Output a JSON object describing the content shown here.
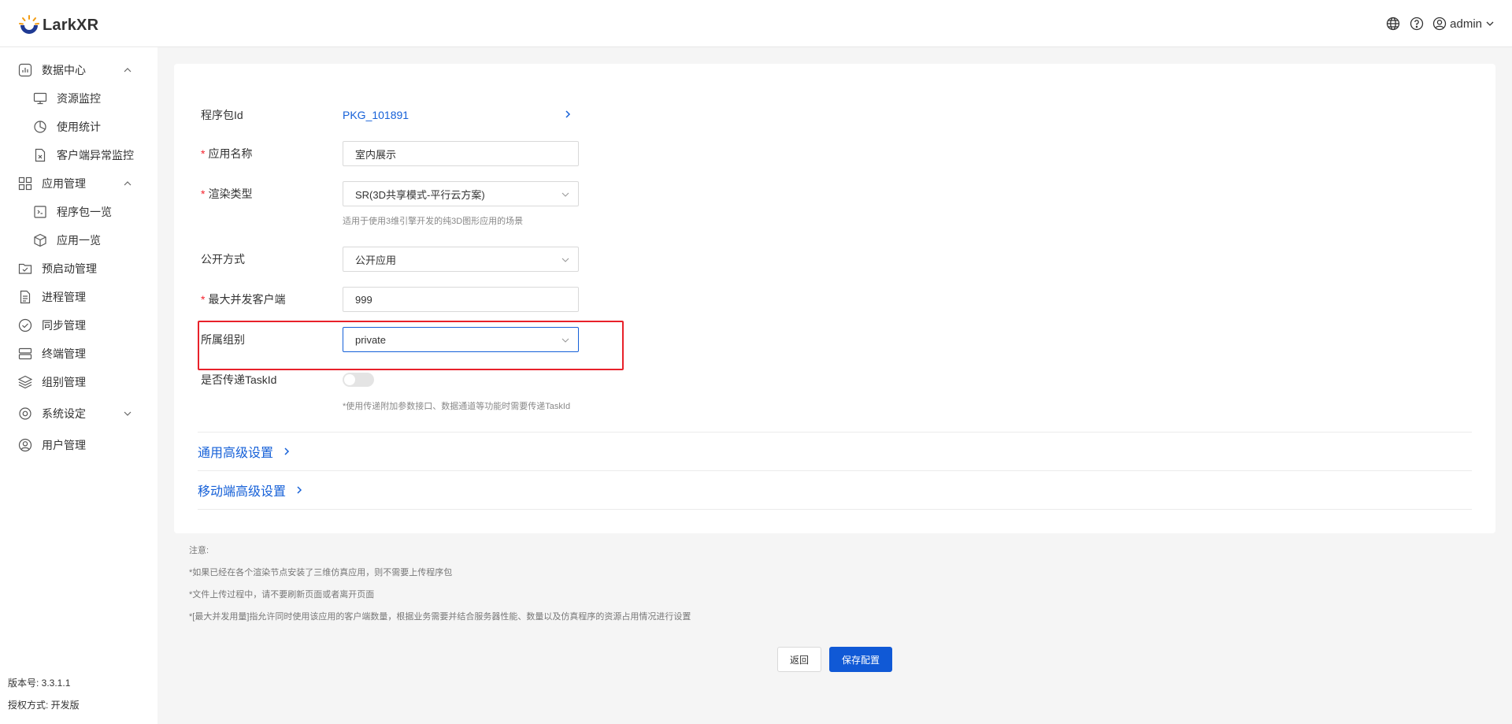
{
  "app": {
    "brand": "LarkXR",
    "user": "admin"
  },
  "colors": {
    "accent": "#1560d8",
    "required": "#f5222d",
    "highlight": "#e8212a",
    "primary_button": "#1059d6"
  },
  "sidebar": {
    "items": [
      {
        "label": "数据中心",
        "icon": "bar-chart-icon"
      },
      {
        "label": "资源监控",
        "icon": "monitor-icon"
      },
      {
        "label": "使用统计",
        "icon": "pie-chart-icon"
      },
      {
        "label": "客户端异常监控",
        "icon": "file-error-icon"
      },
      {
        "label": "应用管理",
        "icon": "app-grid-icon"
      },
      {
        "label": "程序包一览",
        "icon": "package-icon"
      },
      {
        "label": "应用一览",
        "icon": "cube-icon"
      },
      {
        "label": "预启动管理",
        "icon": "folder-check-icon"
      },
      {
        "label": "进程管理",
        "icon": "document-icon"
      },
      {
        "label": "同步管理",
        "icon": "check-circle-icon"
      },
      {
        "label": "终端管理",
        "icon": "server-icon"
      },
      {
        "label": "组别管理",
        "icon": "layers-icon"
      },
      {
        "label": "系统设定",
        "icon": "settings-icon"
      },
      {
        "label": "用户管理",
        "icon": "user-icon"
      }
    ],
    "version": "版本号: 3.3.1.1",
    "license": "授权方式: 开发版"
  },
  "form": {
    "package_id_label": "程序包Id",
    "package_id_value": "PKG_101891",
    "app_name_label": "应用名称",
    "app_name_value": "室内展示",
    "render_type_label": "渲染类型",
    "render_type_value": "SR(3D共享模式-平行云方案)",
    "render_type_hint": "适用于使用3维引擎开发的纯3D图形应用的场景",
    "public_mode_label": "公开方式",
    "public_mode_value": "公开应用",
    "max_clients_label": "最大并发客户端",
    "max_clients_value": "999",
    "group_label": "所属组别",
    "group_value": "private",
    "pass_taskid_label": "是否传递TaskId",
    "pass_taskid_on": false,
    "pass_taskid_hint": "*使用传递附加参数接口、数据通道等功能时需要传递TaskId",
    "general_advanced": "通用高级设置",
    "mobile_advanced": "移动端高级设置"
  },
  "notes": {
    "title": "注意:",
    "lines": [
      "*如果已经在各个渲染节点安装了三维仿真应用，则不需要上传程序包",
      "*文件上传过程中，请不要刷新页面或者离开页面",
      "*[最大并发用量]指允许同时使用该应用的客户端数量，根据业务需要并结合服务器性能、数量以及仿真程序的资源占用情况进行设置"
    ]
  },
  "buttons": {
    "back": "返回",
    "save": "保存配置"
  }
}
